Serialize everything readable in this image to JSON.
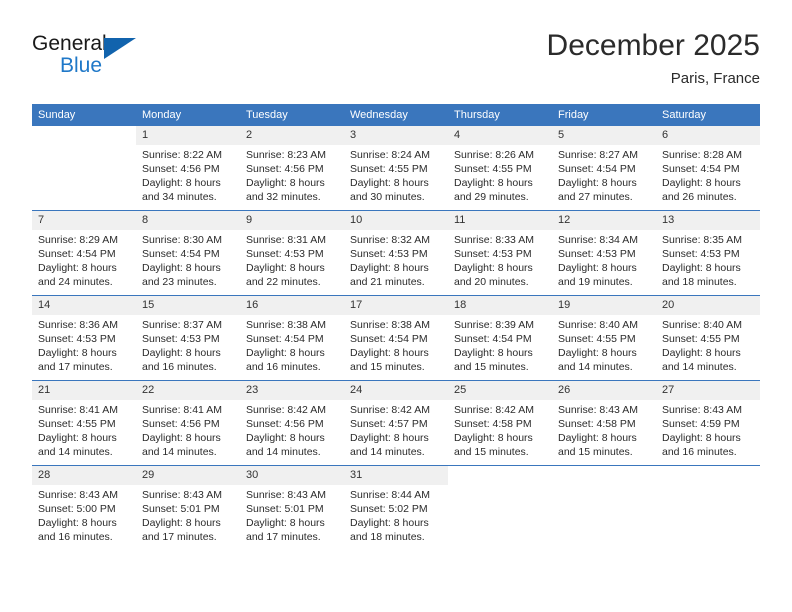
{
  "brand": {
    "name_part1": "General",
    "name_part2": "Blue"
  },
  "header": {
    "title": "December 2025",
    "subtitle": "Paris, France"
  },
  "colors": {
    "header_blue": "#3a76bd",
    "logo_blue": "#1f78c8",
    "daynum_background": "#f0f0f0"
  },
  "weekday_headers": [
    "Sunday",
    "Monday",
    "Tuesday",
    "Wednesday",
    "Thursday",
    "Friday",
    "Saturday"
  ],
  "weeks": [
    [
      {
        "day": "",
        "sunrise": "",
        "sunset": "",
        "daylight1": "",
        "daylight2": "",
        "blank": true
      },
      {
        "day": "1",
        "sunrise": "Sunrise: 8:22 AM",
        "sunset": "Sunset: 4:56 PM",
        "daylight1": "Daylight: 8 hours",
        "daylight2": "and 34 minutes."
      },
      {
        "day": "2",
        "sunrise": "Sunrise: 8:23 AM",
        "sunset": "Sunset: 4:56 PM",
        "daylight1": "Daylight: 8 hours",
        "daylight2": "and 32 minutes."
      },
      {
        "day": "3",
        "sunrise": "Sunrise: 8:24 AM",
        "sunset": "Sunset: 4:55 PM",
        "daylight1": "Daylight: 8 hours",
        "daylight2": "and 30 minutes."
      },
      {
        "day": "4",
        "sunrise": "Sunrise: 8:26 AM",
        "sunset": "Sunset: 4:55 PM",
        "daylight1": "Daylight: 8 hours",
        "daylight2": "and 29 minutes."
      },
      {
        "day": "5",
        "sunrise": "Sunrise: 8:27 AM",
        "sunset": "Sunset: 4:54 PM",
        "daylight1": "Daylight: 8 hours",
        "daylight2": "and 27 minutes."
      },
      {
        "day": "6",
        "sunrise": "Sunrise: 8:28 AM",
        "sunset": "Sunset: 4:54 PM",
        "daylight1": "Daylight: 8 hours",
        "daylight2": "and 26 minutes."
      }
    ],
    [
      {
        "day": "7",
        "sunrise": "Sunrise: 8:29 AM",
        "sunset": "Sunset: 4:54 PM",
        "daylight1": "Daylight: 8 hours",
        "daylight2": "and 24 minutes."
      },
      {
        "day": "8",
        "sunrise": "Sunrise: 8:30 AM",
        "sunset": "Sunset: 4:54 PM",
        "daylight1": "Daylight: 8 hours",
        "daylight2": "and 23 minutes."
      },
      {
        "day": "9",
        "sunrise": "Sunrise: 8:31 AM",
        "sunset": "Sunset: 4:53 PM",
        "daylight1": "Daylight: 8 hours",
        "daylight2": "and 22 minutes."
      },
      {
        "day": "10",
        "sunrise": "Sunrise: 8:32 AM",
        "sunset": "Sunset: 4:53 PM",
        "daylight1": "Daylight: 8 hours",
        "daylight2": "and 21 minutes."
      },
      {
        "day": "11",
        "sunrise": "Sunrise: 8:33 AM",
        "sunset": "Sunset: 4:53 PM",
        "daylight1": "Daylight: 8 hours",
        "daylight2": "and 20 minutes."
      },
      {
        "day": "12",
        "sunrise": "Sunrise: 8:34 AM",
        "sunset": "Sunset: 4:53 PM",
        "daylight1": "Daylight: 8 hours",
        "daylight2": "and 19 minutes."
      },
      {
        "day": "13",
        "sunrise": "Sunrise: 8:35 AM",
        "sunset": "Sunset: 4:53 PM",
        "daylight1": "Daylight: 8 hours",
        "daylight2": "and 18 minutes."
      }
    ],
    [
      {
        "day": "14",
        "sunrise": "Sunrise: 8:36 AM",
        "sunset": "Sunset: 4:53 PM",
        "daylight1": "Daylight: 8 hours",
        "daylight2": "and 17 minutes."
      },
      {
        "day": "15",
        "sunrise": "Sunrise: 8:37 AM",
        "sunset": "Sunset: 4:53 PM",
        "daylight1": "Daylight: 8 hours",
        "daylight2": "and 16 minutes."
      },
      {
        "day": "16",
        "sunrise": "Sunrise: 8:38 AM",
        "sunset": "Sunset: 4:54 PM",
        "daylight1": "Daylight: 8 hours",
        "daylight2": "and 16 minutes."
      },
      {
        "day": "17",
        "sunrise": "Sunrise: 8:38 AM",
        "sunset": "Sunset: 4:54 PM",
        "daylight1": "Daylight: 8 hours",
        "daylight2": "and 15 minutes."
      },
      {
        "day": "18",
        "sunrise": "Sunrise: 8:39 AM",
        "sunset": "Sunset: 4:54 PM",
        "daylight1": "Daylight: 8 hours",
        "daylight2": "and 15 minutes."
      },
      {
        "day": "19",
        "sunrise": "Sunrise: 8:40 AM",
        "sunset": "Sunset: 4:55 PM",
        "daylight1": "Daylight: 8 hours",
        "daylight2": "and 14 minutes."
      },
      {
        "day": "20",
        "sunrise": "Sunrise: 8:40 AM",
        "sunset": "Sunset: 4:55 PM",
        "daylight1": "Daylight: 8 hours",
        "daylight2": "and 14 minutes."
      }
    ],
    [
      {
        "day": "21",
        "sunrise": "Sunrise: 8:41 AM",
        "sunset": "Sunset: 4:55 PM",
        "daylight1": "Daylight: 8 hours",
        "daylight2": "and 14 minutes."
      },
      {
        "day": "22",
        "sunrise": "Sunrise: 8:41 AM",
        "sunset": "Sunset: 4:56 PM",
        "daylight1": "Daylight: 8 hours",
        "daylight2": "and 14 minutes."
      },
      {
        "day": "23",
        "sunrise": "Sunrise: 8:42 AM",
        "sunset": "Sunset: 4:56 PM",
        "daylight1": "Daylight: 8 hours",
        "daylight2": "and 14 minutes."
      },
      {
        "day": "24",
        "sunrise": "Sunrise: 8:42 AM",
        "sunset": "Sunset: 4:57 PM",
        "daylight1": "Daylight: 8 hours",
        "daylight2": "and 14 minutes."
      },
      {
        "day": "25",
        "sunrise": "Sunrise: 8:42 AM",
        "sunset": "Sunset: 4:58 PM",
        "daylight1": "Daylight: 8 hours",
        "daylight2": "and 15 minutes."
      },
      {
        "day": "26",
        "sunrise": "Sunrise: 8:43 AM",
        "sunset": "Sunset: 4:58 PM",
        "daylight1": "Daylight: 8 hours",
        "daylight2": "and 15 minutes."
      },
      {
        "day": "27",
        "sunrise": "Sunrise: 8:43 AM",
        "sunset": "Sunset: 4:59 PM",
        "daylight1": "Daylight: 8 hours",
        "daylight2": "and 16 minutes."
      }
    ],
    [
      {
        "day": "28",
        "sunrise": "Sunrise: 8:43 AM",
        "sunset": "Sunset: 5:00 PM",
        "daylight1": "Daylight: 8 hours",
        "daylight2": "and 16 minutes."
      },
      {
        "day": "29",
        "sunrise": "Sunrise: 8:43 AM",
        "sunset": "Sunset: 5:01 PM",
        "daylight1": "Daylight: 8 hours",
        "daylight2": "and 17 minutes."
      },
      {
        "day": "30",
        "sunrise": "Sunrise: 8:43 AM",
        "sunset": "Sunset: 5:01 PM",
        "daylight1": "Daylight: 8 hours",
        "daylight2": "and 17 minutes."
      },
      {
        "day": "31",
        "sunrise": "Sunrise: 8:44 AM",
        "sunset": "Sunset: 5:02 PM",
        "daylight1": "Daylight: 8 hours",
        "daylight2": "and 18 minutes."
      },
      {
        "day": "",
        "sunrise": "",
        "sunset": "",
        "daylight1": "",
        "daylight2": "",
        "blank": true
      },
      {
        "day": "",
        "sunrise": "",
        "sunset": "",
        "daylight1": "",
        "daylight2": "",
        "blank": true
      },
      {
        "day": "",
        "sunrise": "",
        "sunset": "",
        "daylight1": "",
        "daylight2": "",
        "blank": true
      }
    ]
  ]
}
